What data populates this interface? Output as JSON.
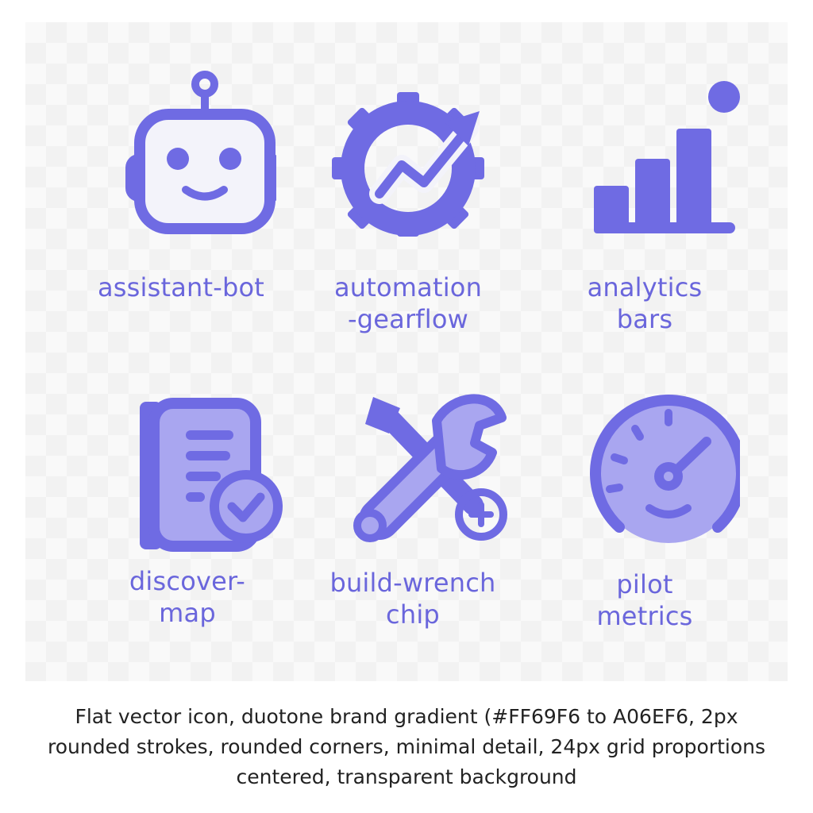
{
  "brand": {
    "icon_color": "#6F6BE3",
    "icon_fill_light": "#A9A6F0",
    "face_fill": "#F3F3FA",
    "label_color": "#6A66DC"
  },
  "icons": [
    {
      "id": "assistant-bot",
      "icon": "robot-icon",
      "label_line1": "assistant-bot",
      "label_line2": ""
    },
    {
      "id": "automation-gearflow",
      "icon": "gear-trend-icon",
      "label_line1": "automation",
      "label_line2": "-gearflow"
    },
    {
      "id": "analytics-bars",
      "icon": "bar-chart-icon",
      "label_line1": "analytics",
      "label_line2": "bars"
    },
    {
      "id": "discover-map",
      "icon": "document-check-icon",
      "label_line1": "discover-",
      "label_line2": "map"
    },
    {
      "id": "build-wrench-chip",
      "icon": "wrench-screwdriver-icon",
      "label_line1": "build-wrench",
      "label_line2": "chip"
    },
    {
      "id": "pilot-metrics",
      "icon": "speedometer-icon",
      "label_line1": "pilot",
      "label_line2": "metrics"
    }
  ],
  "caption": {
    "line1": "Flat vector icon, duotone brand gradient (#FF69F6 to A06EF6, 2px",
    "line2": "rounded strokes, rounded corners, minimal detail, 24px grid proportions",
    "line3": "centered, transparent background"
  }
}
